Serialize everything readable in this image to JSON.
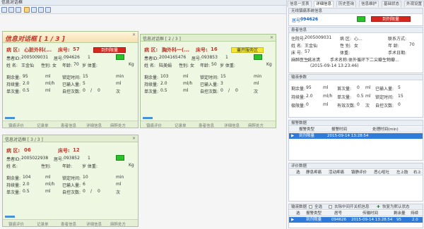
{
  "app": {
    "title": "信息对话框"
  },
  "dialog1": {
    "title": "信息对话框 [ 1 / 3 ]",
    "ward_label": "病  区:",
    "ward_value": "心脏外科(...",
    "bed_label": "床号:",
    "bed_value": "57",
    "alarm_label": "到剂限量",
    "patient_id_label": "患者ID:",
    "patient_id_value": "2005009031",
    "bed_no_label": "居号:",
    "bed_no_value": "094626",
    "bed_count": "1",
    "name_label": "姓  名:",
    "name_value": "王金仙",
    "gender_label": "性别:",
    "gender_value": "女",
    "age_label": "年龄:",
    "age_value": "70",
    "weight_label": "岁 体重:",
    "weight_unit": "Kg",
    "rows": [
      {
        "label": "剩余量:",
        "value": "95",
        "unit": "ml",
        "label2": "锁定时间:",
        "value2": "15",
        "unit2": "min"
      },
      {
        "label": "持续量:",
        "value": "2.0",
        "unit": "ml/h",
        "label2": "已输入量:",
        "value2": "5",
        "unit2": "ml"
      },
      {
        "label": "单次量:",
        "value": "0.5",
        "unit": "ml",
        "label2": "自控次数:",
        "value2": "0",
        "sep": "/",
        "value3": "0",
        "unit2": "次"
      }
    ],
    "footer": [
      "镇痛评价",
      "记录单",
      "患者信息",
      "详细信息",
      "麻醉处方"
    ]
  },
  "dialog2": {
    "title": "信息对话框 [ 2 / 3 ]",
    "ward_label": "病  区:",
    "ward_value": "胸外科一(...",
    "bed_label": "床号:",
    "bed_value": "16",
    "alarm_label": "蓋开服务区",
    "patient_id_label": "患者ID:",
    "patient_id_value": "2004165476",
    "bed_no_label": "居号:",
    "bed_no_value": "093853",
    "bed_count": "1",
    "name_label": "姓  名:",
    "name_value": "陆美娟",
    "gender_label": "性别:",
    "gender_value": "女",
    "age_label": "年龄:",
    "age_value": "50",
    "weight_label": "岁 体重:",
    "weight_unit": "Kg",
    "rows": [
      {
        "label": "剩余量:",
        "value": "103",
        "unit": "ml",
        "label2": "锁定时间:",
        "value2": "15",
        "unit2": "min"
      },
      {
        "label": "持续量:",
        "value": "2.0",
        "unit": "ml/h",
        "label2": "已输入量:",
        "value2": "3",
        "unit2": "ml"
      },
      {
        "label": "单次量:",
        "value": "0.5",
        "unit": "ml",
        "label2": "自控次数:",
        "value2": "0",
        "sep": "/",
        "value3": "0",
        "unit2": "次"
      }
    ],
    "footer": [
      "镇痛评价",
      "记录单",
      "患者信息",
      "详细信息",
      "麻醉处方"
    ]
  },
  "dialog3": {
    "title": "信息对话框 [ 3 / 3 ]",
    "ward_label": "病  区:",
    "ward_value": "06",
    "bed_label": "床号:",
    "bed_value": "12",
    "patient_id_label": "患者ID:",
    "patient_id_value": "2005022938",
    "bed_no_label": "居号:",
    "bed_no_value": "093852",
    "bed_count": "1",
    "name_label": "姓  名:",
    "gender_label": "性别:",
    "age_label": "年龄:",
    "weight_label": "岁 体重:",
    "weight_unit": "Kg",
    "rows": [
      {
        "label": "剩余量:",
        "value": "104",
        "unit": "ml",
        "label2": "锁定时间:",
        "value2": "10",
        "unit2": "min"
      },
      {
        "label": "持续量:",
        "value": "2.0",
        "unit": "ml/h",
        "label2": "已输入量:",
        "value2": "6",
        "unit2": "ml"
      },
      {
        "label": "单次量:",
        "value": "0.5",
        "unit": "ml",
        "label2": "自控次数:",
        "value2": "0",
        "sep": "/",
        "value3": "0",
        "unit2": "次"
      }
    ],
    "footer": [
      "镇痛评价",
      "记录单",
      "患者信息",
      "详细信息",
      "麻醉处方"
    ]
  },
  "right": {
    "tabs": [
      "信息一览表",
      "详细信息",
      "历史查询",
      "信息维护",
      "基础状态",
      "外观设置"
    ],
    "panel_title": "无线镇痛系统信息",
    "summary": {
      "bed_label": "居号:",
      "bed_value": "094626",
      "alarm_label": "到剂限量"
    },
    "patient_section": "患者信息",
    "patient": [
      {
        "label": "住院号:",
        "value": "2005009031",
        "label2": "病  区:",
        "value2": "心...",
        "label3": "联系方式:",
        "value3": ""
      },
      {
        "label": "姓  名:",
        "value": "王金仙",
        "label2": "性 别:",
        "value2": "女",
        "label3": "年  龄:",
        "value3": "70"
      },
      {
        "label": "床  号:",
        "value": "57",
        "label2": "体重:",
        "value2": "",
        "label3": "手术日期:",
        "value3": ""
      }
    ],
    "anesthetist_label": "麻醉医生:",
    "anesthetist_value": "姚冰淸",
    "surgery_label": "手术名称:",
    "surgery_value": "体外循环下二尖瓣生物瓣...",
    "surgery_time": "(2015-09-14 13:23:46)",
    "infusion_section": "输液参数",
    "infusion": [
      {
        "label": "剩余量:",
        "value": "95",
        "unit": "ml",
        "label2": "首次量:",
        "value2": "0",
        "unit2": "ml",
        "label3": "已输入量:",
        "value3": "5"
      },
      {
        "label": "持续量:",
        "value": "2.0",
        "unit": "ml/h",
        "label2": "单次量:",
        "value2": "0.5",
        "unit2": "ml",
        "label3": "锁定时间:",
        "value3": "15"
      },
      {
        "label": "极限量:",
        "value": "0",
        "unit": "ml",
        "label2": "有效次数:",
        "value2": "0",
        "unit2": "次",
        "label3": "自控次数:",
        "value3": "0"
      }
    ],
    "alarm_section": "报警数据",
    "alarm_cols": [
      "报警类型",
      "报警时间",
      "处理时间(min)"
    ],
    "alarm_row": {
      "type": "到剂限量",
      "time": "2015-09-14 13:28:54",
      "handle": ""
    },
    "eval_section": "评价数据",
    "eval_cols": [
      "选",
      "静息疼痛",
      "活动疼痛",
      "镇静评价",
      "恶心呕吐",
      "左上肢",
      "右上"
    ],
    "infusion_data_section": "输液数据",
    "opt_all": "全选",
    "opt_remove": "去除中间开关机信息",
    "opt_restore": "恢复为默认状态",
    "infusion_cols": [
      "选",
      "报警类型",
      "居号",
      "传输时间",
      "剩余量",
      "持续"
    ],
    "infusion_row": {
      "type": "到剂限量",
      "bed": "094626",
      "time": "2015-09-14 13:28:54",
      "remain": "95",
      "cont": "2.0"
    }
  }
}
